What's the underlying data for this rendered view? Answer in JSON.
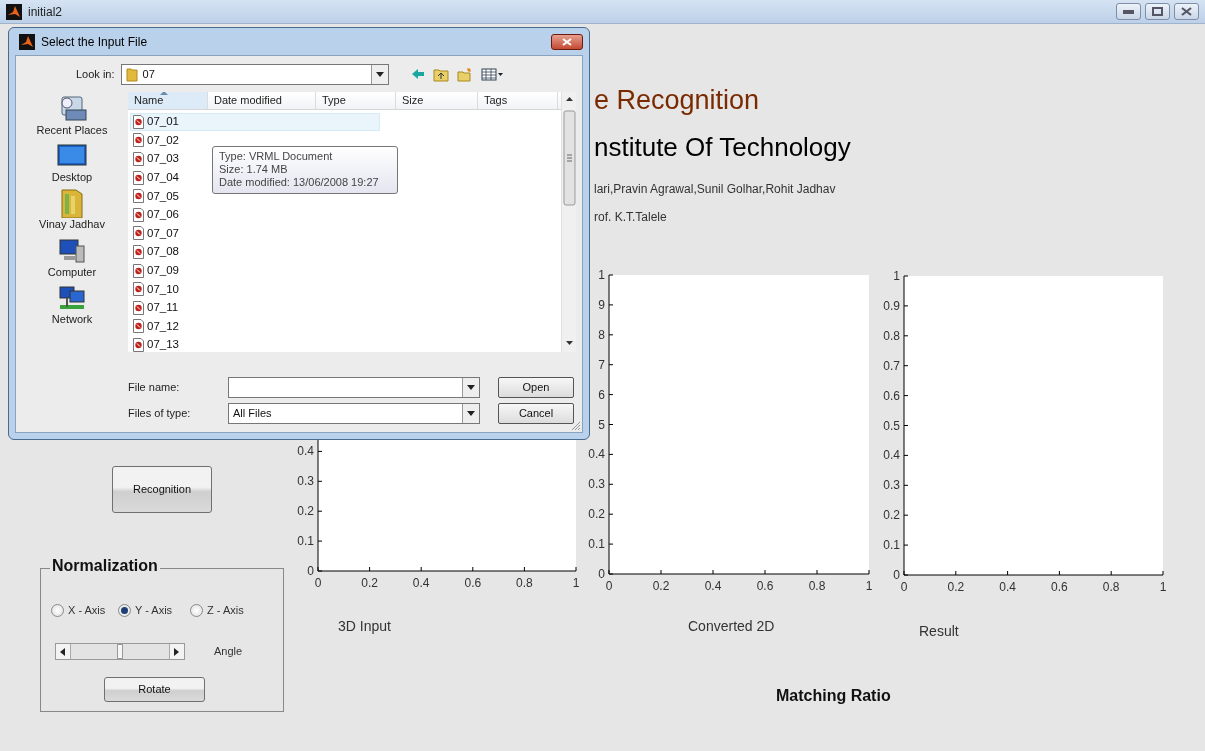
{
  "window": {
    "title": "initial2"
  },
  "header": {
    "title": "e Recognition",
    "institute": "nstitute Of Technology",
    "authors": "lari,Pravin Agrawal,Sunil Golhar,Rohit Jadhav",
    "guide": "rof. K.T.Talele"
  },
  "recognition_button": "Recognition",
  "normalization": {
    "title": "Normalization",
    "axes": [
      {
        "label": "X - Axis",
        "selected": false
      },
      {
        "label": "Y - Axis",
        "selected": true
      },
      {
        "label": "Z - Axis",
        "selected": false
      }
    ],
    "angle_slider": {
      "level": 0.5
    },
    "angle_label": "Angle",
    "rotate_button": "Rotate"
  },
  "plots": [
    {
      "caption": "3D Input",
      "chart_data": {
        "type": "line",
        "xlim": [
          0,
          1
        ],
        "ylim": [
          0,
          1
        ],
        "xticks": [
          0,
          0.2,
          0.4,
          0.6,
          0.8,
          1
        ],
        "yticks": [
          0,
          0.1,
          0.2,
          0.3,
          0.4
        ]
      }
    },
    {
      "caption": "Converted 2D",
      "chart_data": {
        "type": "line",
        "xlim": [
          0,
          1
        ],
        "ylim": [
          0,
          1
        ],
        "xticks": [
          0,
          0.2,
          0.4,
          0.6,
          0.8,
          1
        ],
        "yticks": [
          0,
          0.1,
          0.2,
          0.3,
          0.4,
          1
        ]
      },
      "covered_tick_labels": [
        "9",
        "8",
        "7",
        "6",
        "5"
      ]
    },
    {
      "caption": "Result",
      "chart_data": {
        "type": "line",
        "xlim": [
          0,
          1
        ],
        "ylim": [
          0,
          1
        ],
        "xticks": [
          0,
          0.2,
          0.4,
          0.6,
          0.8,
          1
        ],
        "yticks": [
          0,
          0.1,
          0.2,
          0.3,
          0.4,
          0.5,
          0.6,
          0.7,
          0.8,
          0.9,
          1
        ]
      }
    }
  ],
  "matching_ratio_label": "Matching Ratio",
  "dialog": {
    "title": "Select the Input File",
    "look_in_label": "Look in:",
    "look_in_value": "07",
    "places": [
      {
        "label": "Recent Places",
        "kind": "recent"
      },
      {
        "label": "Desktop",
        "kind": "desktop"
      },
      {
        "label": "Vinay Jadhav",
        "kind": "user"
      },
      {
        "label": "Computer",
        "kind": "computer"
      },
      {
        "label": "Network",
        "kind": "network"
      }
    ],
    "columns": [
      {
        "label": "Name",
        "sorted": true
      },
      {
        "label": "Date modified",
        "sorted": false
      },
      {
        "label": "Type",
        "sorted": false
      },
      {
        "label": "Size",
        "sorted": false
      },
      {
        "label": "Tags",
        "sorted": false
      }
    ],
    "files": [
      {
        "name": "07_01",
        "hovered": true
      },
      {
        "name": "07_02",
        "hovered": false
      },
      {
        "name": "07_03",
        "hovered": false
      },
      {
        "name": "07_04",
        "hovered": false
      },
      {
        "name": "07_05",
        "hovered": false
      },
      {
        "name": "07_06",
        "hovered": false
      },
      {
        "name": "07_07",
        "hovered": false
      },
      {
        "name": "07_08",
        "hovered": false
      },
      {
        "name": "07_09",
        "hovered": false
      },
      {
        "name": "07_10",
        "hovered": false
      },
      {
        "name": "07_11",
        "hovered": false
      },
      {
        "name": "07_12",
        "hovered": false
      },
      {
        "name": "07_13",
        "hovered": false
      }
    ],
    "tooltip": [
      "Type: VRML Document",
      "Size: 1.74 MB",
      "Date modified: 13/06/2008 19:27"
    ],
    "file_name_label": "File name:",
    "file_type_label": "Files of type:",
    "file_type_value": "All Files",
    "buttons": [
      "Open",
      "Cancel"
    ]
  }
}
